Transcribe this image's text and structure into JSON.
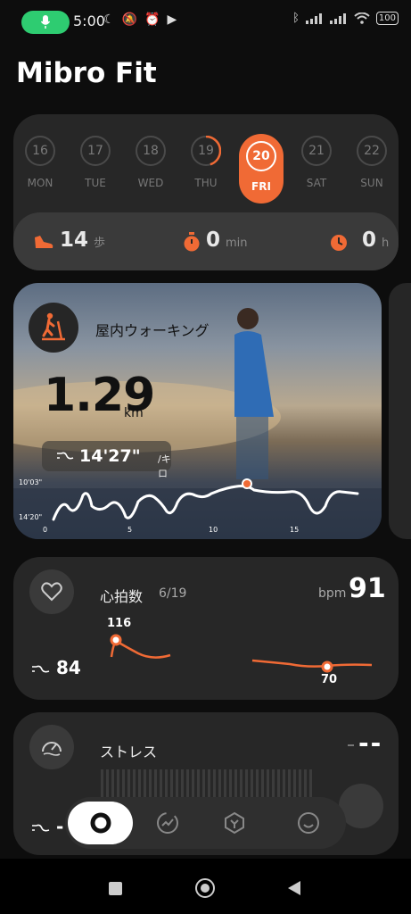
{
  "status_bar": {
    "time": "5:00",
    "battery": "100"
  },
  "app": {
    "title": "Mibro Fit"
  },
  "week": {
    "days": [
      {
        "date": "16",
        "name": "MON"
      },
      {
        "date": "17",
        "name": "TUE"
      },
      {
        "date": "18",
        "name": "WED"
      },
      {
        "date": "19",
        "name": "THU"
      },
      {
        "date": "20",
        "name": "FRI"
      },
      {
        "date": "21",
        "name": "SAT"
      },
      {
        "date": "22",
        "name": "SUN"
      }
    ],
    "selected_index": 4,
    "thu_progress": 0.45
  },
  "summary": {
    "steps": {
      "value": "14",
      "unit": "歩"
    },
    "minutes": {
      "value": "0",
      "unit": "min"
    },
    "hours": {
      "value": "0",
      "unit": "h"
    }
  },
  "activity": {
    "title": "屋内ウォーキング",
    "distance": "1.29",
    "distance_unit": "km",
    "pace": "14'27\"",
    "pace_unit": "/キロ",
    "chart_data": {
      "type": "line",
      "y_labels": [
        "10'03\"",
        "14'20\""
      ],
      "x_ticks": [
        "0",
        "5",
        "10",
        "15"
      ]
    }
  },
  "heart": {
    "title": "心拍数",
    "date": "6/19",
    "unit": "bpm",
    "current": "91",
    "resting": "84",
    "max": "116",
    "min": "70"
  },
  "stress": {
    "title": "ストレス",
    "value": "--",
    "resting": "-"
  },
  "colors": {
    "accent": "#f06a35",
    "card": "#272727",
    "background": "#0d0d0d",
    "mic": "#2ecc71"
  }
}
